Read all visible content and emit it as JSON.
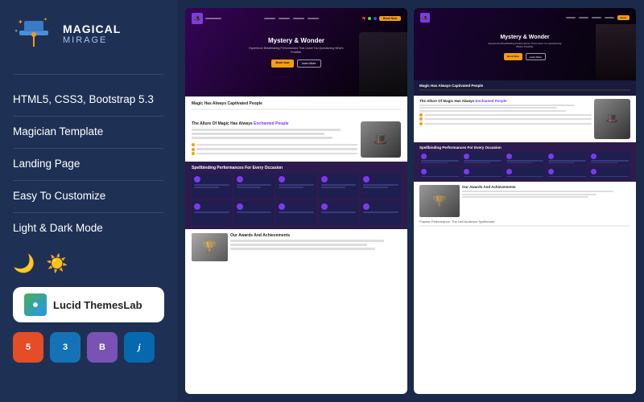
{
  "leftPanel": {
    "logo": {
      "name": "MAGICAL",
      "sub": "MIRAGE"
    },
    "features": [
      "HTML5, CSS3, Bootstrap 5.3",
      "Magician Template",
      "Landing Page",
      "Easy To Customize",
      "Light & Dark Mode"
    ],
    "badge": {
      "icon": "🌿",
      "text": "Lucid ThemesLab"
    },
    "techBadges": [
      {
        "label": "HTML5",
        "class": "badge-html",
        "symbol": "5"
      },
      {
        "label": "CSS3",
        "class": "badge-css",
        "symbol": "3"
      },
      {
        "label": "BS",
        "class": "badge-bs",
        "symbol": "B"
      },
      {
        "label": "jQuery",
        "class": "badge-jq",
        "symbol": "j"
      }
    ]
  },
  "preview": {
    "heroTitle": "Mystery & Wonder",
    "heroSub": "Experience Breathtaking Performances That Leave You Questioning What's Possible.",
    "section1Title": "Magic Has Always Captivated People",
    "section2Title": "The Allure Of Magic Has Always Enchanted People",
    "section3Title": "Spellbinding Performances For Every Occasion",
    "section4Title": "Our Awards And Achievements",
    "btnPrimary": "Book Now",
    "btnOutline": "Learn More"
  }
}
